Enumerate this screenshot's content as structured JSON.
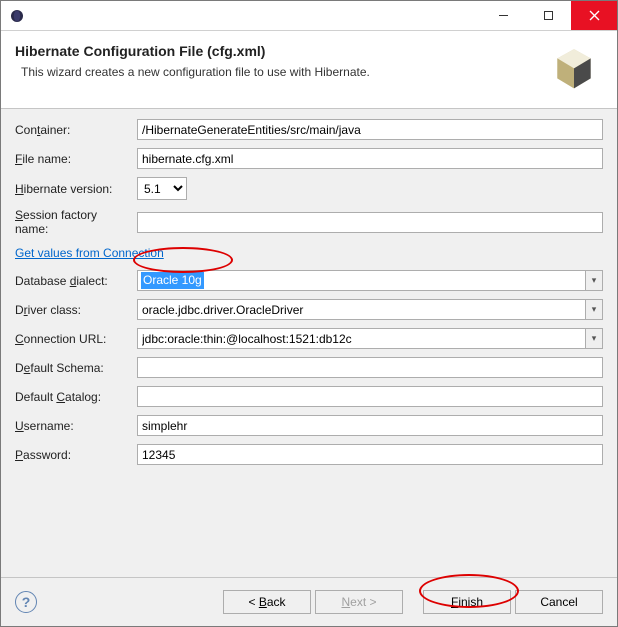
{
  "titlebar": {
    "buttons": {
      "minimize": "Minimize",
      "maximize": "Maximize",
      "close": "Close"
    }
  },
  "header": {
    "title": "Hibernate Configuration File (cfg.xml)",
    "description": "This wizard creates a new configuration file to use with Hibernate."
  },
  "form": {
    "container": {
      "label_pre": "Con",
      "label_u": "t",
      "label_post": "ainer:",
      "value": "/HibernateGenerateEntities/src/main/java"
    },
    "filename": {
      "label_pre": "",
      "label_u": "F",
      "label_post": "ile name:",
      "value": "hibernate.cfg.xml"
    },
    "hibernate_version": {
      "label_pre": "",
      "label_u": "H",
      "label_post": "ibernate version:",
      "value": "5.1"
    },
    "session_factory": {
      "label_pre": "",
      "label_u": "S",
      "label_post": "ession factory name:",
      "value": ""
    },
    "link": "Get values from Connection",
    "dialect": {
      "label_pre": "Database ",
      "label_u": "d",
      "label_post": "ialect:",
      "value": "Oracle 10g"
    },
    "driver": {
      "label_pre": "D",
      "label_u": "r",
      "label_post": "iver class:",
      "value": "oracle.jdbc.driver.OracleDriver"
    },
    "url": {
      "label_pre": "",
      "label_u": "C",
      "label_post": "onnection URL:",
      "value": "jdbc:oracle:thin:@localhost:1521:db12c"
    },
    "schema": {
      "label_pre": "D",
      "label_u": "e",
      "label_post": "fault Schema:",
      "value": ""
    },
    "catalog": {
      "label_pre": "Default ",
      "label_u": "C",
      "label_post": "atalog:",
      "value": ""
    },
    "username": {
      "label_pre": "",
      "label_u": "U",
      "label_post": "sername:",
      "value": "simplehr"
    },
    "password": {
      "label_pre": "",
      "label_u": "P",
      "label_post": "assword:",
      "value": "12345"
    }
  },
  "footer": {
    "back": {
      "pre": "< ",
      "u": "B",
      "post": "ack"
    },
    "next": {
      "pre": "",
      "u": "N",
      "post": "ext >"
    },
    "finish": {
      "pre": "",
      "u": "F",
      "post": "inish"
    },
    "cancel": "Cancel",
    "help": "?"
  }
}
